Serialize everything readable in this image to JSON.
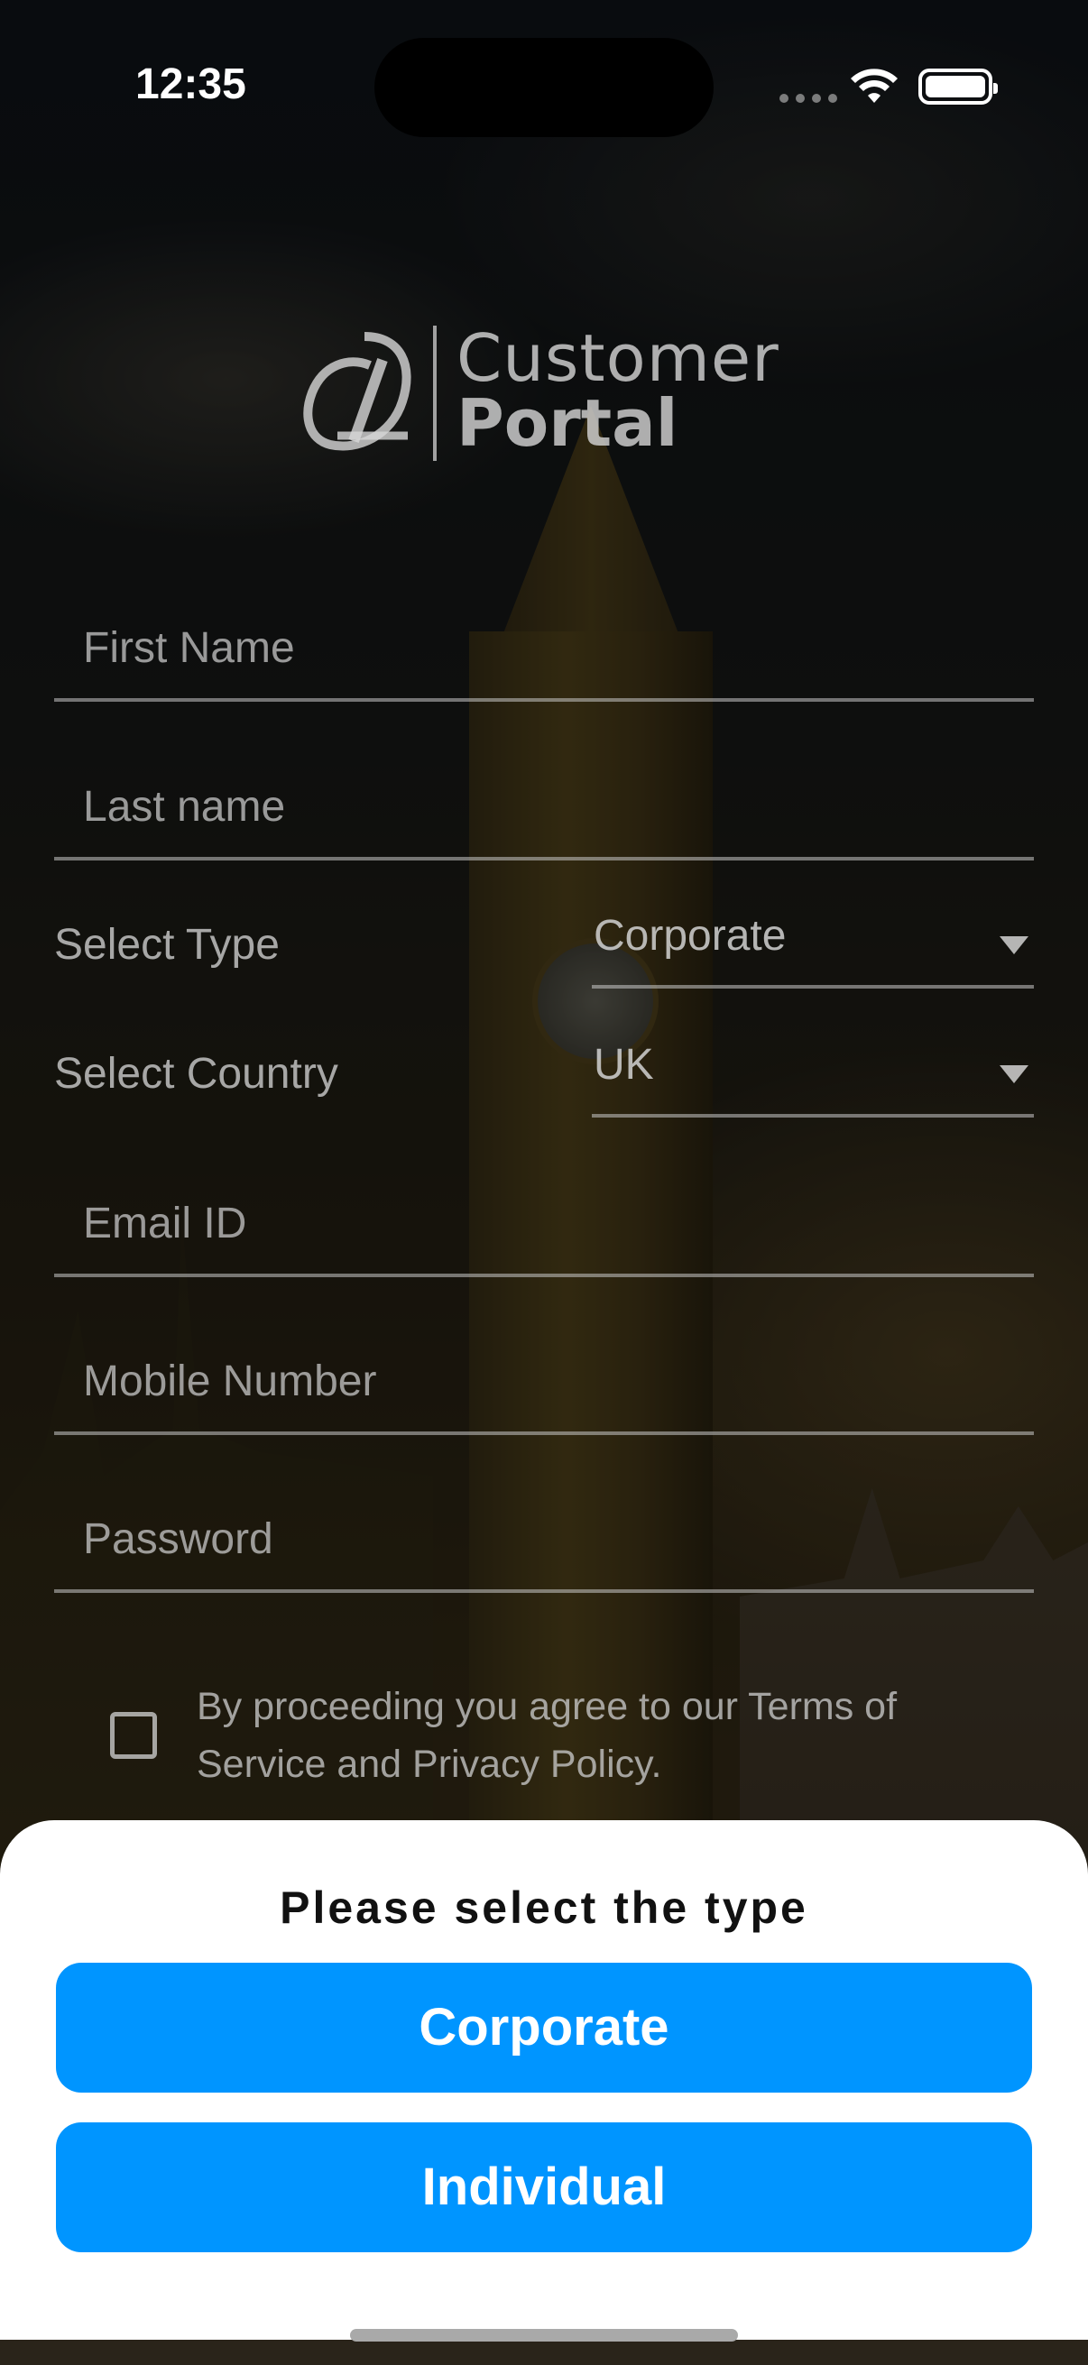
{
  "status_bar": {
    "time": "12:35"
  },
  "logo": {
    "line1": "Customer",
    "line2": "Portal"
  },
  "form": {
    "first_name_placeholder": "First Name",
    "last_name_placeholder": "Last name",
    "select_type_label": "Select Type",
    "select_type_value": "Corporate",
    "select_country_label": "Select Country",
    "select_country_value": "UK",
    "email_placeholder": "Email ID",
    "mobile_placeholder": "Mobile Number",
    "password_placeholder": "Password",
    "terms_text": "By proceeding you agree to our Terms of Service and Privacy Policy.",
    "terms_checked": false
  },
  "sheet": {
    "title": "Please select the type",
    "options": [
      "Corporate",
      "Individual"
    ],
    "button_color": "#0095ff"
  }
}
